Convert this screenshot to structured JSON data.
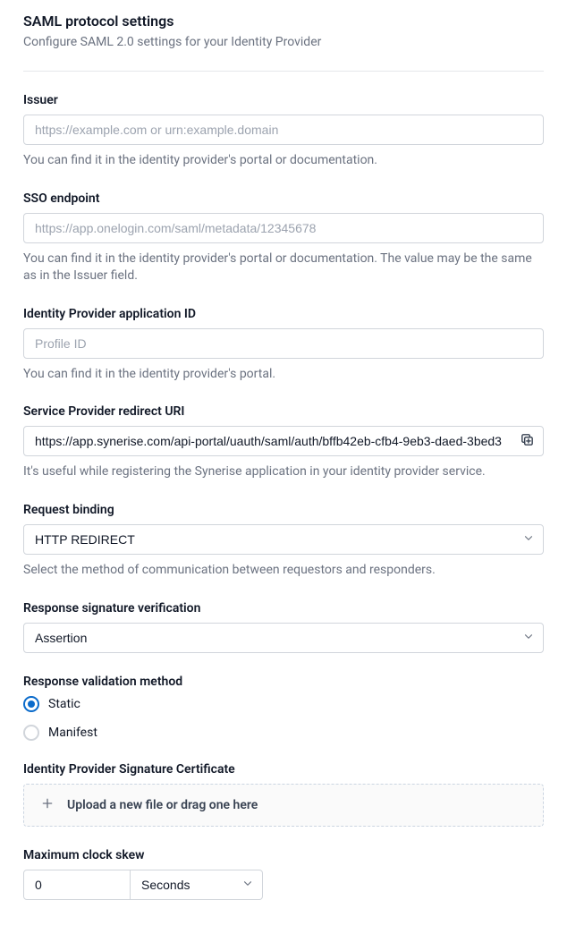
{
  "header": {
    "title": "SAML protocol settings",
    "subtitle": "Configure SAML 2.0 settings for your Identity Provider"
  },
  "issuer": {
    "label": "Issuer",
    "placeholder": "https://example.com or urn:example.domain",
    "value": "",
    "helper": "You can find it in the identity provider's portal or documentation."
  },
  "sso_endpoint": {
    "label": "SSO endpoint",
    "placeholder": "https://app.onelogin.com/saml/metadata/12345678",
    "value": "",
    "helper": "You can find it in the identity provider's portal or documentation. The value may be the same as in the Issuer field."
  },
  "idp_app_id": {
    "label": "Identity Provider application ID",
    "placeholder": "Profile ID",
    "value": "",
    "helper": "You can find it in the identity provider's portal."
  },
  "sp_redirect_uri": {
    "label": "Service Provider redirect URI",
    "value": "https://app.synerise.com/api-portal/uauth/saml/auth/bffb42eb-cfb4-9eb3-daed-3bed3",
    "helper": "It's useful while registering the Synerise application in your identity provider service."
  },
  "request_binding": {
    "label": "Request binding",
    "selected": "HTTP REDIRECT",
    "helper": "Select the method of communication between requestors and responders."
  },
  "response_sig_verify": {
    "label": "Response signature verification",
    "selected": "Assertion"
  },
  "response_validation": {
    "label": "Response validation method",
    "options": [
      "Static",
      "Manifest"
    ],
    "selected": "Static"
  },
  "idp_cert": {
    "label": "Identity Provider Signature Certificate",
    "dropzone_text": "Upload a new file or drag one here"
  },
  "clock_skew": {
    "label": "Maximum clock skew",
    "value": "0",
    "unit": "Seconds"
  }
}
